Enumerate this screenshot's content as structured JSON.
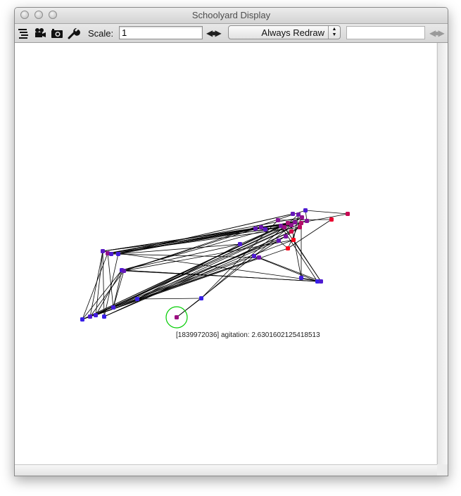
{
  "window": {
    "title": "Schoolyard Display"
  },
  "toolbar": {
    "icons": [
      "list-icon",
      "movie-camera-icon",
      "camera-icon",
      "wrench-icon"
    ],
    "scale_label": "Scale:",
    "scale_value": "1",
    "redraw_mode": "Always Redraw",
    "right_value": ""
  },
  "inspection": {
    "text": "[1839972036] agitation: 2.6301602125418513"
  },
  "colors": {
    "edge": "#000000",
    "calm_node": "#2222ff",
    "agitated_node": "#ff0000",
    "selection_ring": "#00cc00"
  }
}
